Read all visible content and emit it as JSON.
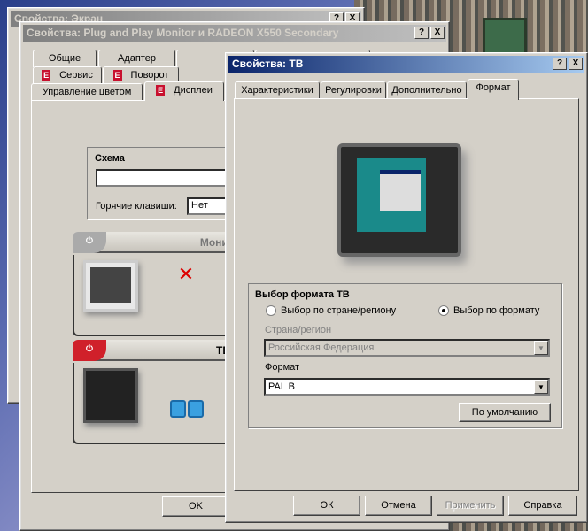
{
  "screen_window": {
    "title": "Свойства: Экран",
    "help": "?",
    "close": "X"
  },
  "monitor_window": {
    "title": "Свойства: Plug and Play Monitor и RADEON X550 Secondary",
    "help": "?",
    "close": "X",
    "tabs_row1": [
      "Общие",
      "Адаптер"
    ],
    "tabs_row2": [
      "Сервис",
      "Поворот"
    ],
    "tabs_row3": [
      "Управление цветом",
      "Дисплеи"
    ],
    "scheme": {
      "title": "Схема",
      "value": "",
      "hotkeys_label": "Горячие клавиши:",
      "hotkeys_value": "Нет"
    },
    "monitor": {
      "label": "Монитор",
      "state": "off"
    },
    "tv": {
      "label": "ТВ",
      "state": "on"
    },
    "ok": "OK"
  },
  "tv_window": {
    "title": "Свойства: ТВ",
    "help": "?",
    "close": "X",
    "tabs": [
      "Характеристики",
      "Регулировки",
      "Дополнительно",
      "Формат"
    ],
    "active_tab": "Формат",
    "group_title": "Выбор формата ТВ",
    "radio_country": "Выбор по стране/региону",
    "radio_format": "Выбор по формату",
    "selected_radio": "format",
    "country_label": "Страна/регион",
    "country_value": "Российская Федерация",
    "format_label": "Формат",
    "format_value": "PAL B",
    "default_button": "По умолчанию",
    "buttons": {
      "ok": "ОК",
      "cancel": "Отмена",
      "apply": "Применить",
      "help": "Справка"
    }
  },
  "colors": {
    "active_title": "#0a246a",
    "ati_red": "#c8102e",
    "face": "#d4d0c8"
  }
}
